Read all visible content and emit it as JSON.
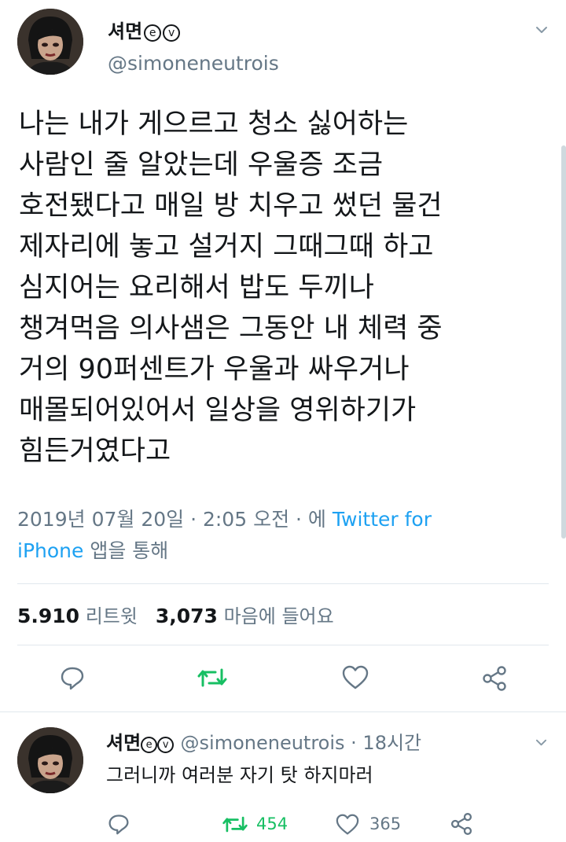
{
  "tweet": {
    "display_name": "셔면",
    "badge_e": "e",
    "badge_v": "v",
    "handle": "@simoneneutrois",
    "text_lines": [
      "나는 내가 게으르고 청소 싫어하는",
      "사람인 줄 알았는데 우울증 조금",
      "호전됐다고 매일 방 치우고 썼던 물건",
      "제자리에 놓고 설거지 그때그때 하고",
      "심지어는 요리해서 밥도 두끼나",
      "챙겨먹음 의사샘은 그동안 내 체력 중",
      "거의 90퍼센트가 우울과 싸우거나",
      "매몰되어있어서 일상을 영위하기가",
      "힘든거였다고"
    ],
    "timestamp": "2019년 07월 20일 · 2:05 오전 · 에",
    "source_link_part1": "Twitter for",
    "source_link_part2": "iPhone",
    "source_suffix": "앱을 통해",
    "retweet_count": "5.910",
    "retweet_label": "리트윗",
    "like_count": "3,073",
    "like_label": "마음에 들어요"
  },
  "reply": {
    "display_name": "셔면",
    "badge_e": "e",
    "badge_v": "v",
    "handle_time": "@simoneneutrois · 18시간",
    "text": "그러니까 여러분 자기 탓 하지마러",
    "retweet_count": "454",
    "like_count": "365"
  },
  "colors": {
    "accent": "#1da1f2",
    "retweet": "#17bf63",
    "secondary_text": "#657786",
    "divider": "#e1e8ed"
  },
  "icons": {
    "reply": "reply-icon",
    "retweet": "retweet-icon",
    "like": "heart-icon",
    "share": "share-icon",
    "caret": "chevron-down-icon"
  }
}
